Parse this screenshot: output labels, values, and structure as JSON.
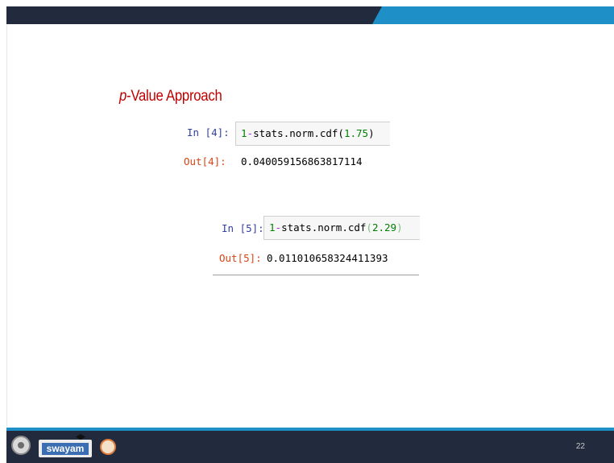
{
  "slide": {
    "title_italic": "p",
    "title_rest": "-Value Approach",
    "page_number": "22"
  },
  "cells": [
    {
      "in_prompt": "In [4]:",
      "code_prefix": "1",
      "code_op": "-",
      "code_func": "stats.norm.cdf(",
      "code_arg": "1.75",
      "code_close": ")",
      "out_prompt": "Out[4]:",
      "output": "0.040059156863817114"
    },
    {
      "in_prompt": "In [5]:",
      "code_prefix": "1",
      "code_op": "-",
      "code_func": "stats.norm.cdf",
      "code_open": "(",
      "code_arg": "2.29",
      "code_close": ")",
      "out_prompt": "Out[5]:",
      "output": "0.011010658324411393"
    }
  ],
  "footer": {
    "swayam_label": "swayam"
  },
  "colors": {
    "banner_dark": "#222a3d",
    "banner_accent": "#1f8fc7",
    "title_red": "#c00000"
  }
}
